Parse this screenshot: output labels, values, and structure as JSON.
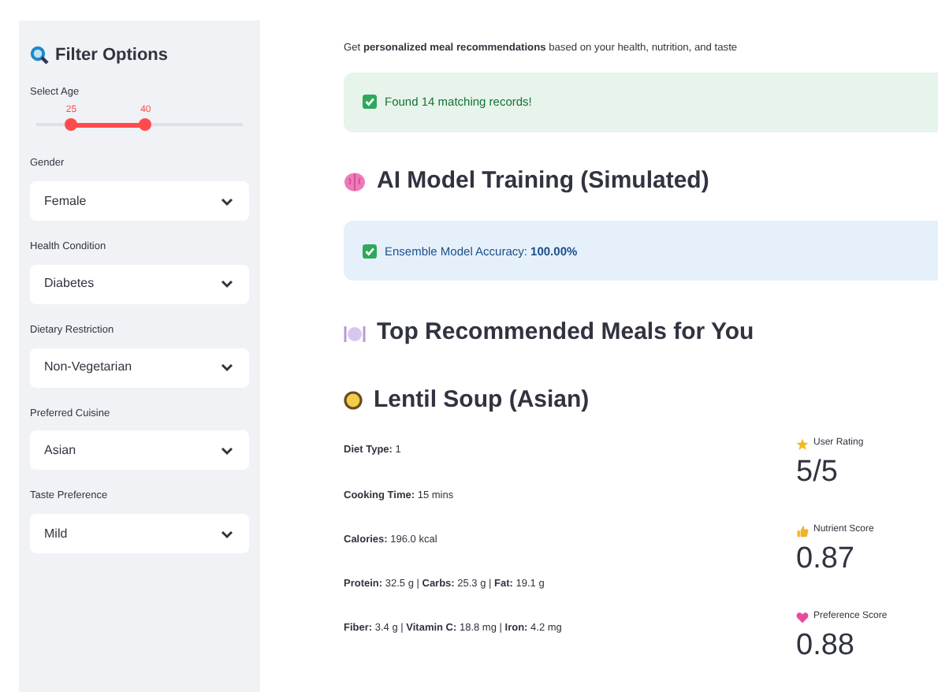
{
  "sidebar": {
    "title": "Filter Options",
    "age_slider": {
      "label": "Select Age",
      "thumbs": [
        {
          "label": "25",
          "level": 0.17
        },
        {
          "label": "40",
          "level": 0.53
        }
      ]
    },
    "selects": [
      {
        "label": "Gender",
        "value": "Female"
      },
      {
        "label": "Health Condition",
        "value": "Diabetes"
      },
      {
        "label": "Dietary Restriction",
        "value": "Non-Vegetarian"
      },
      {
        "label": "Preferred Cuisine",
        "value": "Asian"
      },
      {
        "label": "Taste Preference",
        "value": "Mild"
      }
    ]
  },
  "main": {
    "intro": "Get **personalized meal recommendations** based on your health, nutrition, and taste",
    "alerts_top": [
      {
        "kind": "success",
        "text": "Found 14 matching records!"
      }
    ],
    "training_heading": "AI Model Training (Simulated)",
    "alerts_training": [
      {
        "kind": "info",
        "text": "Ensemble Model Accuracy: **100.00%**"
      }
    ],
    "recommend_heading": "Top Recommended Meals for You",
    "meal": {
      "title": "Lentil Soup (Asian)",
      "details": [
        "**Diet Type:** 1",
        "**Cooking Time:** 15 mins",
        "**Calories:** 196.0 kcal",
        "**Protein:** 32.5 g | **Carbs:** 25.3 g | **Fat:** 19.1 g",
        "**Fiber:** 3.4 g | **Vitamin C:** 18.8 mg | **Iron:** 4.2 mg"
      ],
      "metrics": [
        {
          "kind": "star",
          "label": "User Rating",
          "value": "5/5"
        },
        {
          "kind": "thumb",
          "label": "Nutrient Score",
          "value": "0.87"
        },
        {
          "kind": "heart",
          "label": "Preference Score",
          "value": "0.88"
        }
      ]
    }
  }
}
